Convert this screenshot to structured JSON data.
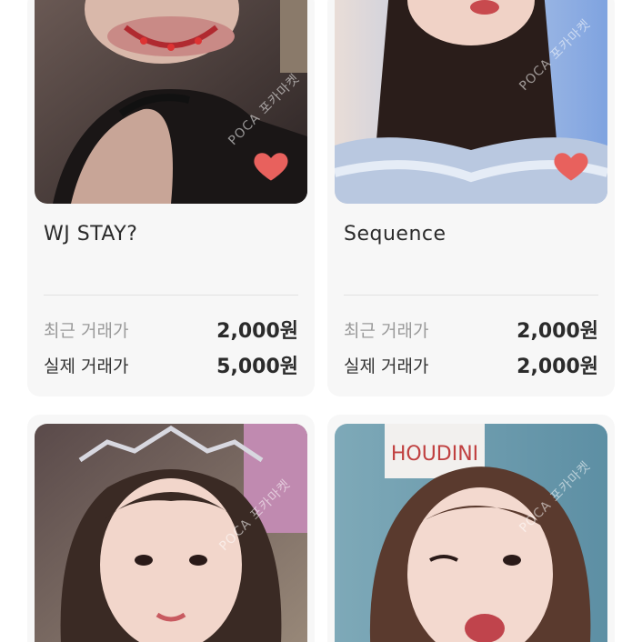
{
  "colors": {
    "card_bg": "#f7f7f7",
    "heart": "#e8615d",
    "divider": "#e2e2e2",
    "label_muted": "#9a9a9a",
    "text_dark": "#2b2b2b"
  },
  "watermark_text": "POCA 포카마켓",
  "cards": [
    {
      "title": "WJ STAY?",
      "recent_price_label": "최근 거래가",
      "recent_price": "2,000원",
      "actual_price_label": "실제 거래가",
      "actual_price": "5,000원",
      "favorite_icon": "heart-icon",
      "photo": "photocard-image"
    },
    {
      "title": "Sequence",
      "recent_price_label": "최근 거래가",
      "recent_price": "2,000원",
      "actual_price_label": "실제 거래가",
      "actual_price": "2,000원",
      "favorite_icon": "heart-icon",
      "photo": "photocard-image"
    },
    {
      "photo": "photocard-image"
    },
    {
      "photo": "photocard-image"
    }
  ]
}
